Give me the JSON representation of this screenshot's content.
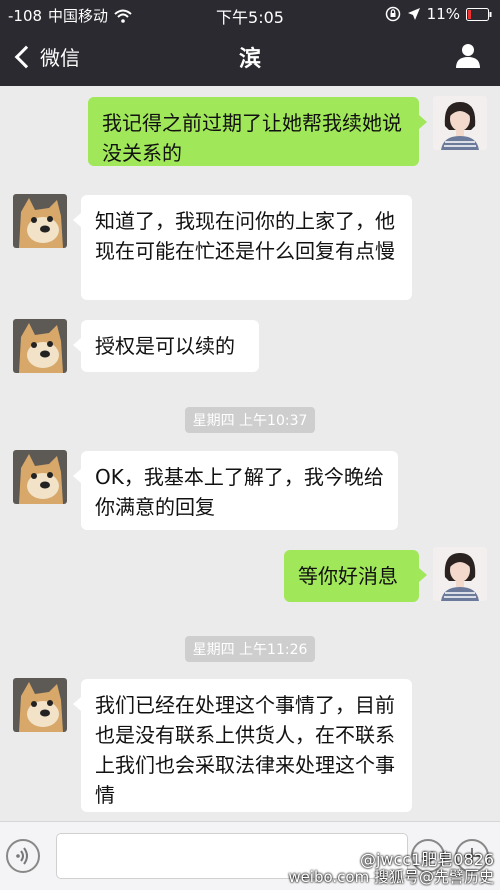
{
  "status": {
    "signal": "-108",
    "carrier": "中国移动",
    "time": "下午5:05",
    "battery": "11%"
  },
  "nav": {
    "back_label": "微信",
    "title": "滨"
  },
  "messages": [
    {
      "side": "out",
      "text": "我记得之前过期了让她帮我续她说没关系的"
    },
    {
      "side": "in",
      "text": "知道了，我现在问你的上家了，他现在可能在忙还是什么回复有点慢"
    },
    {
      "side": "in",
      "text": "授权是可以续的"
    },
    {
      "side": "in",
      "text": "OK，我基本上了解了，我今晚给你满意的回复"
    },
    {
      "side": "out",
      "text": "等你好消息"
    },
    {
      "side": "in",
      "text": "我们已经在处理这个事情了，目前也是没有联系上供货人，在不联系上我们也会采取法律来处理这个事情"
    }
  ],
  "timestamps": [
    "星期四 上午10:37",
    "星期四 上午11:26"
  ],
  "watermarks": [
    "@jwcc1肥皂0826",
    "weibo.com 搜狐号@先譬历史"
  ],
  "colors": {
    "header": "#2b2a30",
    "chat_bg": "#ebebeb",
    "out_bubble": "#a0e759",
    "in_bubble": "#ffffff"
  }
}
